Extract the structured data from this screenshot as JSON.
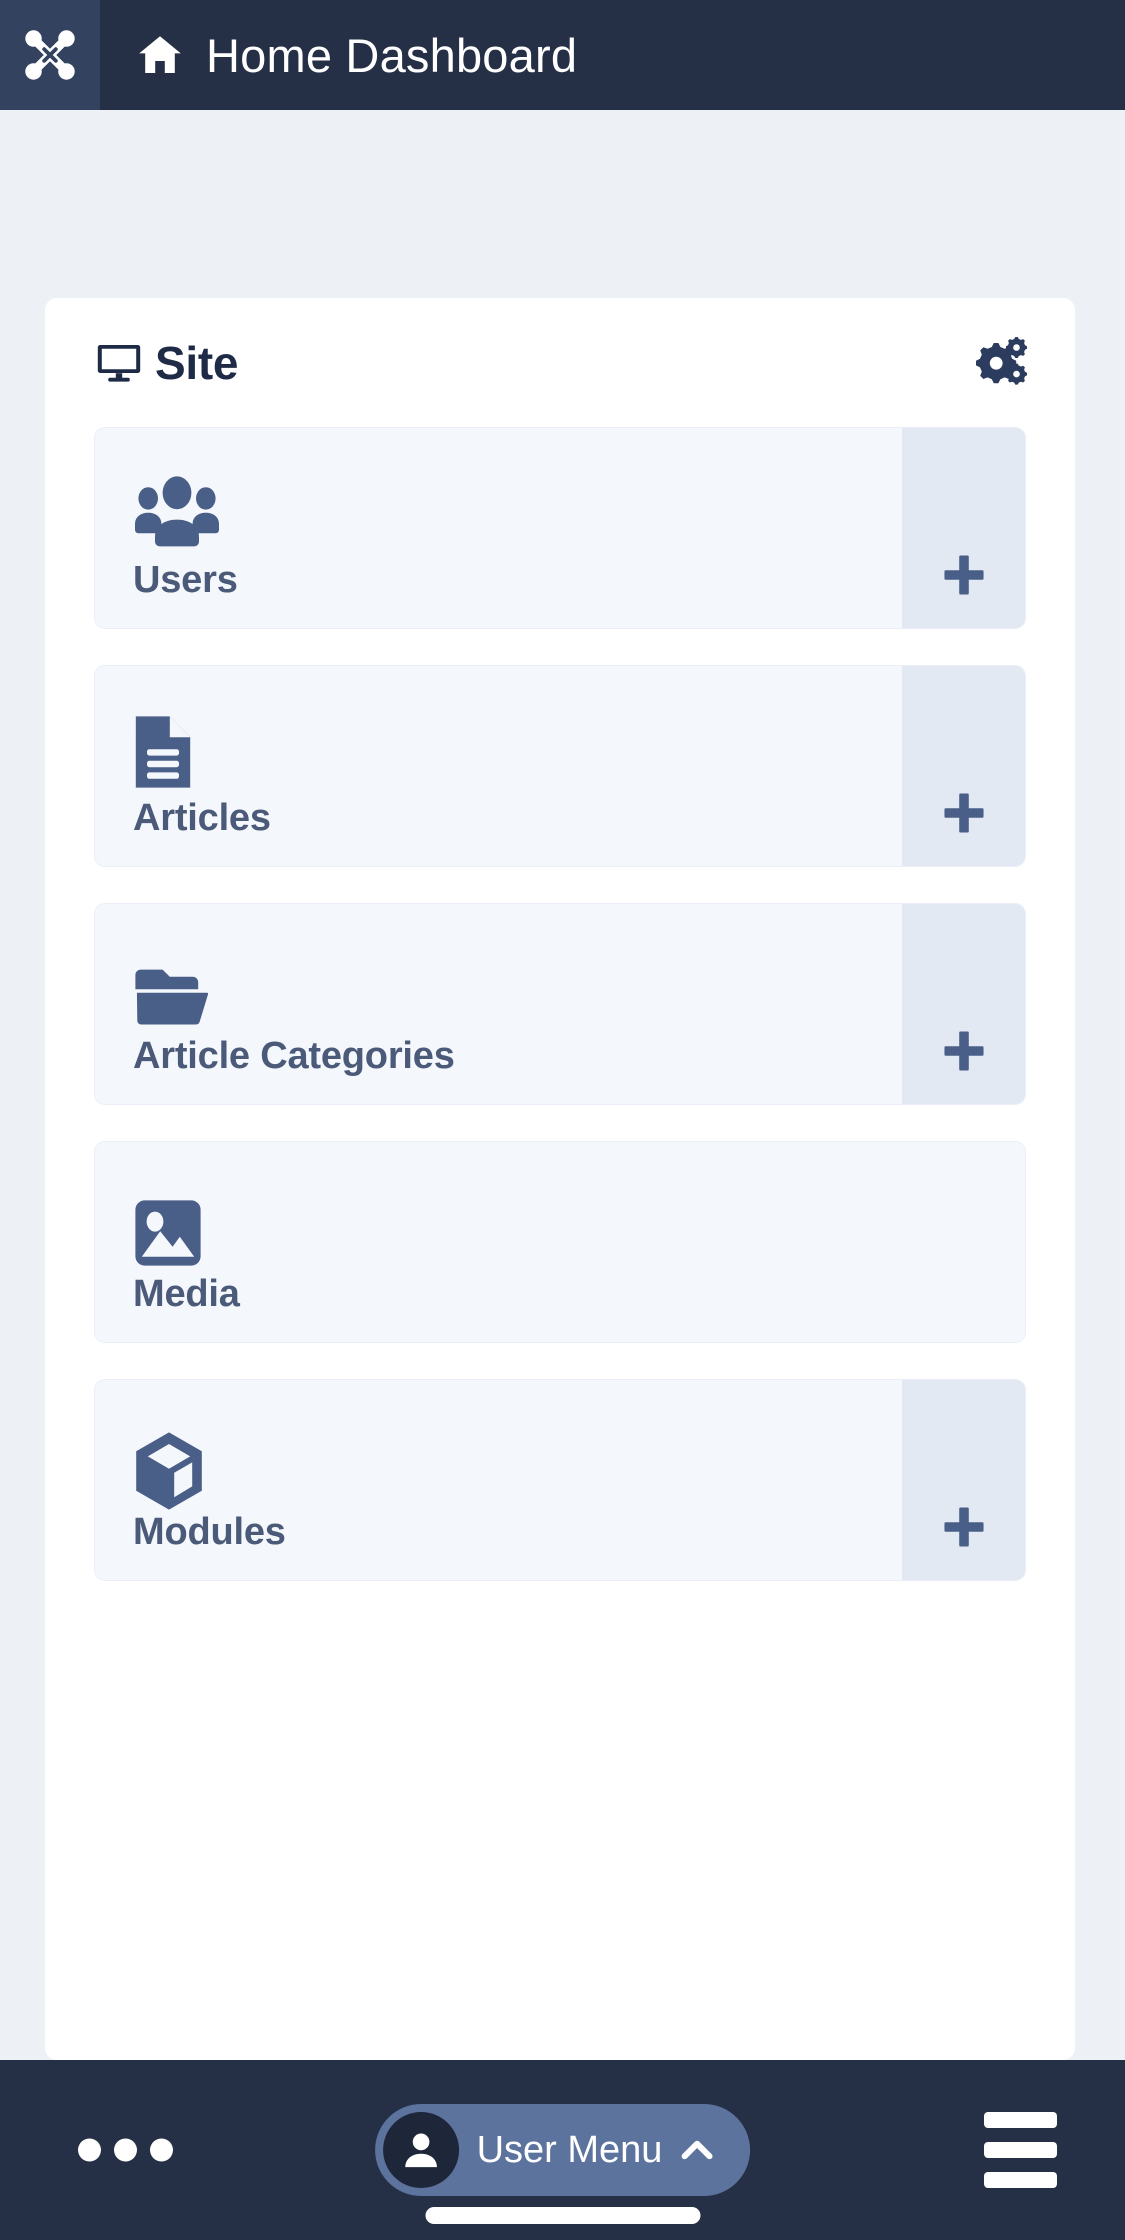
{
  "header": {
    "logo_name": "joomla-logo",
    "home_icon": "home-icon",
    "title": "Home Dashboard",
    "bg_color": "#252f46",
    "logo_bg_color": "#32425f"
  },
  "card": {
    "icon": "monitor-icon",
    "title": "Site",
    "options_icon": "cogs-icon",
    "bg_color": "#ffffff",
    "items": [
      {
        "icon": "users-icon",
        "label": "Users",
        "has_add": true,
        "add_label": "+"
      },
      {
        "icon": "document-icon",
        "label": "Articles",
        "has_add": true,
        "add_label": "+"
      },
      {
        "icon": "open-folder-icon",
        "label": "Article Categories",
        "has_add": true,
        "add_label": "+"
      },
      {
        "icon": "image-icon",
        "label": "Media",
        "has_add": false,
        "add_label": ""
      },
      {
        "icon": "cube-icon",
        "label": "Modules",
        "has_add": true,
        "add_label": "+"
      }
    ]
  },
  "bottom_nav": {
    "more_icon": "three-dots-icon",
    "user_menu": {
      "avatar_icon": "user-avatar-icon",
      "label": "User Menu",
      "chevron_icon": "chevron-up-icon",
      "pill_color": "#5c739e"
    },
    "menu_icon": "hamburger-menu-icon",
    "home_indicator": "home-indicator-bar",
    "bg_color": "#252f46"
  },
  "colors": {
    "page_background": "#edf0f5",
    "tile_background": "#f4f7fc",
    "tile_add_background": "#e3e9f3",
    "icon_blue": "#4a5f87",
    "label_text": "#4a5a78",
    "title_text": "#1f2b46"
  }
}
